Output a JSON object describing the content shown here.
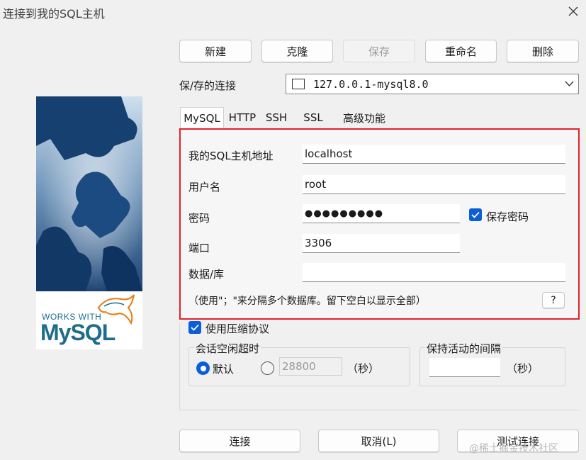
{
  "window": {
    "title": "连接到我的SQL主机"
  },
  "toolbar": {
    "new_label": "新建",
    "clone_label": "克隆",
    "save_label": "保存",
    "rename_label": "重命名",
    "delete_label": "删除"
  },
  "saved_connections": {
    "label": "保/存的连接",
    "selected": "127.0.0.1-mysql8.0"
  },
  "tabs": [
    "MySQL",
    "HTTP",
    "SSH",
    "SSL",
    "高级功能"
  ],
  "form": {
    "host_label": "我的SQL主机地址",
    "host_value": "localhost",
    "user_label": "用户名",
    "user_value": "root",
    "password_label": "密码",
    "password_value": "●●●●●●●●●",
    "save_password_label": "保存密码",
    "port_label": "端口",
    "port_value": "3306",
    "database_label": "数据/库",
    "database_value": "",
    "hint": "（使用\"；\"来分隔多个数据库。留下空白以显示全部）",
    "help_label": "?"
  },
  "compression": {
    "label": "使用压缩协议",
    "checked": true
  },
  "session_timeout": {
    "title": "会话空闲超时",
    "default_label": "默认",
    "custom_value": "28800",
    "unit": "（秒）"
  },
  "keepalive": {
    "title": "保持活动的间隔",
    "value": "",
    "unit": "（秒）"
  },
  "footer": {
    "connect_label": "连接",
    "cancel_label": "取消(L)",
    "test_label": "测试连接"
  },
  "branding": {
    "works_with": "WORKS WITH",
    "logo": "MySQL"
  },
  "watermark": "@稀土掘金技术社区",
  "colors": {
    "accent": "#0a5ed7",
    "highlight_border": "#e0242b"
  }
}
